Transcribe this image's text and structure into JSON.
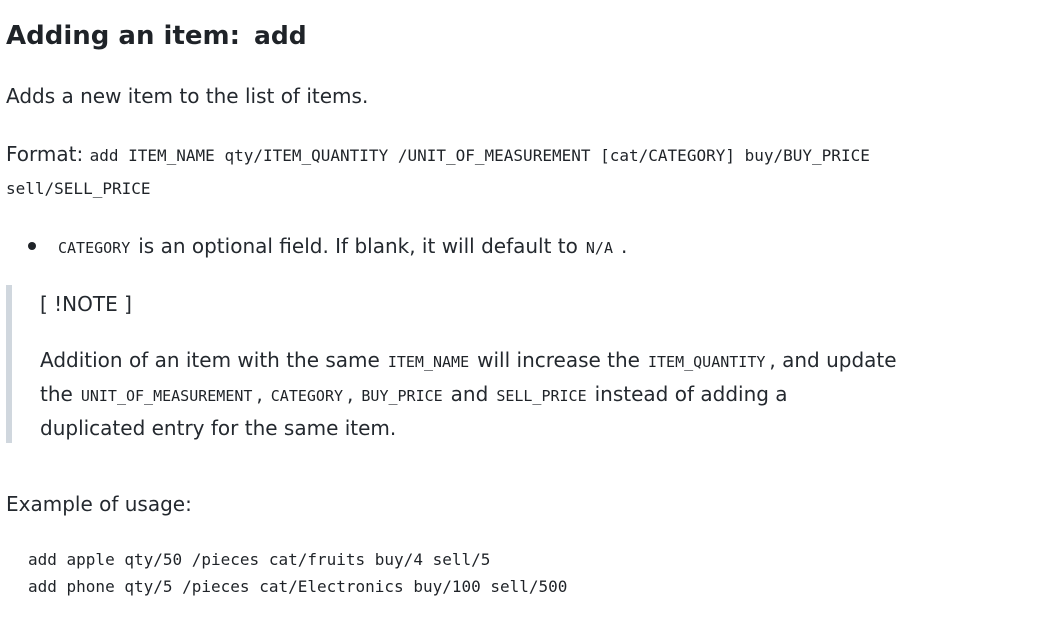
{
  "heading": {
    "text": "Adding an item:",
    "command": "add"
  },
  "intro": "Adds a new item to the list of items.",
  "format": {
    "label": "Format:",
    "line1": "add ITEM_NAME qty/ITEM_QUANTITY /UNIT_OF_MEASUREMENT [cat/CATEGORY] buy/BUY_PRICE",
    "line2": "sell/SELL_PRICE"
  },
  "bullet": {
    "code1": "CATEGORY",
    "text1": "is an optional field. If blank, it will default to",
    "code2": "N/A",
    "text2": "."
  },
  "note": {
    "title": "[ !NOTE ]",
    "line1_text1": "Addition of an item with the same",
    "line1_code1": "ITEM_NAME",
    "line1_text2": "will increase the",
    "line1_code2": "ITEM_QUANTITY",
    "line1_text3": ", and update",
    "line2_text1": "the",
    "line2_code1": "UNIT_OF_MEASUREMENT",
    "line2_sep1": ",",
    "line2_code2": "CATEGORY",
    "line2_sep2": ",",
    "line2_code3": "BUY_PRICE",
    "line2_text2": "and",
    "line2_code4": "SELL_PRICE",
    "line2_text3": "instead of adding a",
    "line3_text1": "duplicated entry for the same item."
  },
  "example": {
    "label": "Example of usage:",
    "lines": [
      "add apple qty/50 /pieces cat/fruits buy/4 sell/5",
      "add phone qty/5 /pieces cat/Electronics buy/100 sell/500"
    ]
  }
}
